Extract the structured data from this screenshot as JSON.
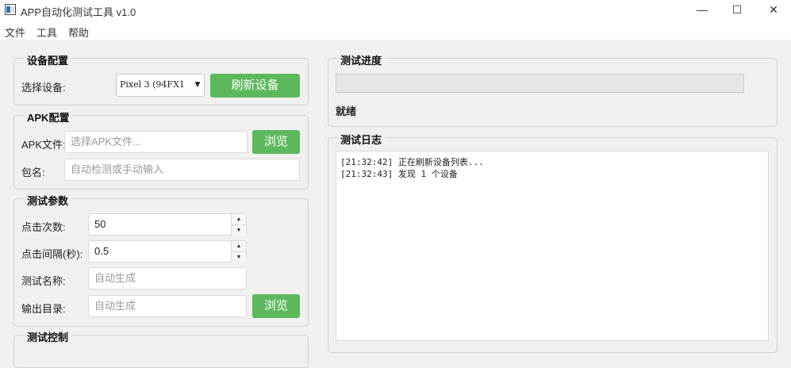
{
  "window": {
    "title": "APP自动化测试工具 v1.0",
    "controls": [
      "—",
      "☐",
      "✕"
    ]
  },
  "menu": [
    "文件",
    "工具",
    "帮助"
  ],
  "device_config": {
    "title": "设备配置",
    "select_label": "选择设备:",
    "selected_device": "Pixel 3 (94FX1",
    "refresh_button": "刷新设备"
  },
  "apk_config": {
    "title": "APK配置",
    "apk_label": "APK文件:",
    "apk_placeholder": "选择APK文件...",
    "browse_button": "浏览",
    "package_label": "包名:",
    "package_placeholder": "自动检测或手动输入"
  },
  "test_params": {
    "title": "测试参数",
    "clicks_label": "点击次数:",
    "clicks_value": "50",
    "interval_label": "点击间隔(秒):",
    "interval_value": "0.5",
    "name_label": "测试名称:",
    "name_placeholder": "自动生成",
    "output_label": "输出目录:",
    "output_placeholder": "自动生成",
    "browse_button": "浏览"
  },
  "test_control": {
    "title": "测试控制"
  },
  "progress": {
    "title": "测试进度",
    "value": 0,
    "status": "就绪"
  },
  "log": {
    "title": "测试日志",
    "lines": [
      "[21:32:42] 正在刷新设备列表...",
      "[21:32:43] 发现 1 个设备"
    ]
  },
  "colors": {
    "accent_green": "#5cb85c",
    "window_bg": "#f0f0f0"
  }
}
